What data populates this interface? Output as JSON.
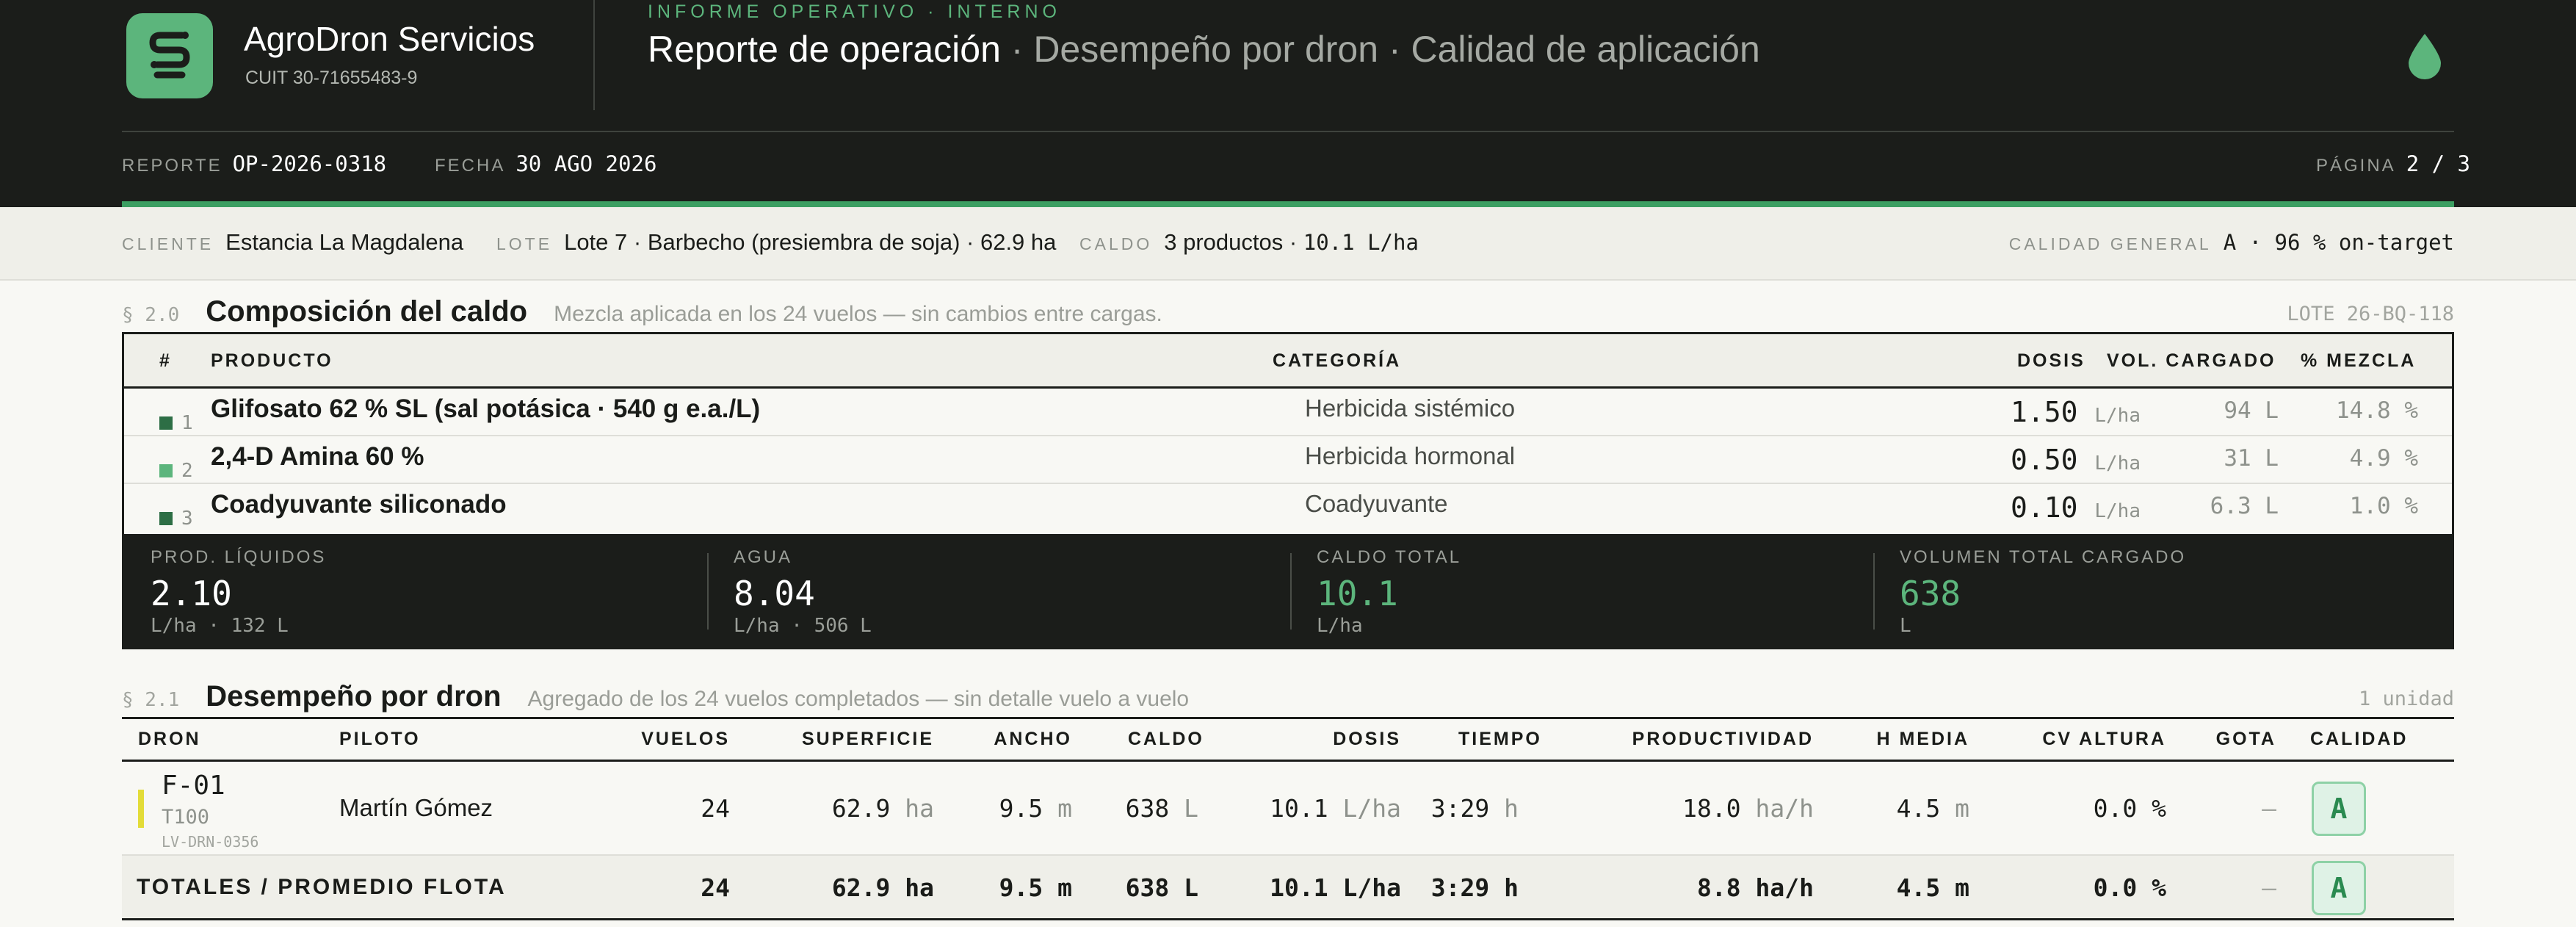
{
  "header": {
    "brand": "AgroDron Servicios",
    "cuit": "CUIT 30-71655483-9",
    "kicker": "INFORME OPERATIVO · INTERNO",
    "title_main": "Reporte de operación",
    "title_rest": " · Desempeño por dron · Calidad de aplicación",
    "report_label": "REPORTE",
    "report_value": "OP-2026-0318",
    "date_label": "FECHA",
    "date_value": "30 AGO 2026",
    "page_label": "PÁGINA",
    "page_value": "2 / 3",
    "logo_icon": "logo-s-icon",
    "drop_icon": "droplet-icon",
    "accent_color": "#5cb57c"
  },
  "band": {
    "client_label": "CLIENTE",
    "client_value": "Estancia La Magdalena",
    "lot_label": "LOTE",
    "lot_value": "Lote 7 · Barbecho (presiembra de soja) · 62.9 ha",
    "broth_label": "CALDO",
    "broth_value_a": "3 productos · ",
    "broth_value_b": "10.1 L/ha",
    "quality_label": "CALIDAD GENERAL",
    "quality_value": "A · 96 % on-target"
  },
  "section1": {
    "num": "§ 2.0",
    "title": "Composición del caldo",
    "subtitle": "Mezcla aplicada en los 24 vuelos — sin cambios entre cargas.",
    "right": "LOTE 26-BQ-118",
    "headers": {
      "num": "#",
      "product": "PRODUCTO",
      "category": "CATEGORÍA",
      "dose": "DOSIS",
      "volume": "VOL. CARGADO",
      "mix": "% MEZCLA"
    },
    "rows": [
      {
        "num": "1",
        "product": "Glifosato 62 % SL (sal potásica · 540 g e.a./L)",
        "category": "Herbicida sistémico",
        "dose": "1.50",
        "dose_unit": "L/ha",
        "volume": "94 L",
        "mix": "14.8 %",
        "color": "#2d6e45"
      },
      {
        "num": "2",
        "product": "2,4-D Amina 60 %",
        "category": "Herbicida hormonal",
        "dose": "0.50",
        "dose_unit": "L/ha",
        "volume": "31 L",
        "mix": "4.9 %",
        "color": "#5cb57c"
      },
      {
        "num": "3",
        "product": "Coadyuvante siliconado",
        "category": "Coadyuvante",
        "dose": "0.10",
        "dose_unit": "L/ha",
        "volume": "6.3 L",
        "mix": "1.0 %",
        "color": "#2d6e45"
      }
    ],
    "footer": [
      {
        "label": "PROD. LÍQUIDOS",
        "value": "2.10",
        "sub": "L/ha · 132 L"
      },
      {
        "label": "AGUA",
        "value": "8.04",
        "sub": "L/ha · 506 L"
      },
      {
        "label": "CALDO TOTAL",
        "value": "10.1",
        "sub": "L/ha"
      },
      {
        "label": "VOLUMEN TOTAL CARGADO",
        "value": "638",
        "sub": "L"
      }
    ]
  },
  "section2": {
    "num": "§ 2.1",
    "title": "Desempeño por dron",
    "subtitle": "Agregado de los 24 vuelos completados — sin detalle vuelo a vuelo",
    "right": "1 unidad",
    "headers": {
      "drone": "DRON",
      "pilot": "PILOTO",
      "flights": "VUELOS",
      "surface": "SUPERFICIE",
      "width": "ANCHO",
      "broth": "CALDO",
      "dose": "DOSIS",
      "time": "TIEMPO",
      "productivity": "PRODUCTIVIDAD",
      "height": "H MEDIA",
      "cv": "CV ALTURA",
      "drop": "GOTA",
      "quality": "CALIDAD"
    },
    "row": {
      "code": "F-01",
      "model": "T100",
      "reg": "LV-DRN-0356",
      "pilot": "Martín Gómez",
      "flights": "24",
      "surface": "62.9",
      "surface_u": "ha",
      "width": "9.5",
      "width_u": "m",
      "broth": "638",
      "broth_u": "L",
      "dose": "10.1",
      "dose_u": "L/ha",
      "time": "3:29",
      "time_u": "h",
      "productivity": "18.0",
      "productivity_u": "ha/h",
      "height": "4.5",
      "height_u": "m",
      "cv": "0.0 %",
      "drop": "—",
      "quality": "A",
      "marker_color": "#e3dc38"
    },
    "totals": {
      "label": "TOTALES / PROMEDIO FLOTA",
      "flights": "24",
      "surface": "62.9",
      "surface_u": "ha",
      "width": "9.5",
      "width_u": "m",
      "broth": "638",
      "broth_u": "L",
      "dose": "10.1",
      "dose_u": "L/ha",
      "time": "3:29",
      "time_u": "h",
      "productivity": "8.8",
      "productivity_u": "ha/h",
      "height": "4.5",
      "height_u": "m",
      "cv": "0.0 %",
      "drop": "—",
      "quality": "A"
    }
  }
}
